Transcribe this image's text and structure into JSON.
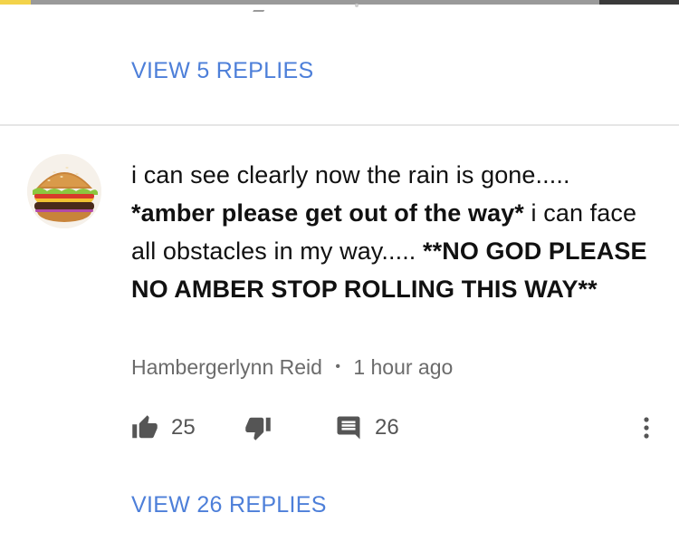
{
  "thread": {
    "view_replies_top": "VIEW 5 REPLIES",
    "view_replies_bottom": "VIEW 26 REPLIES"
  },
  "comment": {
    "text_line1": "i can see clearly now the rain is gone..... ",
    "text_bold1": "*amber please get out of the way*",
    "text_line2": " i can face all obstacles in my way..... ",
    "text_bold2": "**NO GOD PLEASE NO AMBER STOP ROLLING THIS WAY**",
    "author": "Hambergerlynn Reid",
    "separator": "•",
    "time": "1 hour ago",
    "likes": "25",
    "replies": "26"
  },
  "icons": {
    "like": "thumbs-up-icon",
    "dislike": "thumbs-down-icon",
    "reply": "comment-icon",
    "more": "more-vertical-icon",
    "avatar": "hamburger-avatar"
  },
  "colors": {
    "link_blue": "#4d7fd9",
    "meta_gray": "#6b6b6b",
    "icon_gray": "#555555"
  }
}
